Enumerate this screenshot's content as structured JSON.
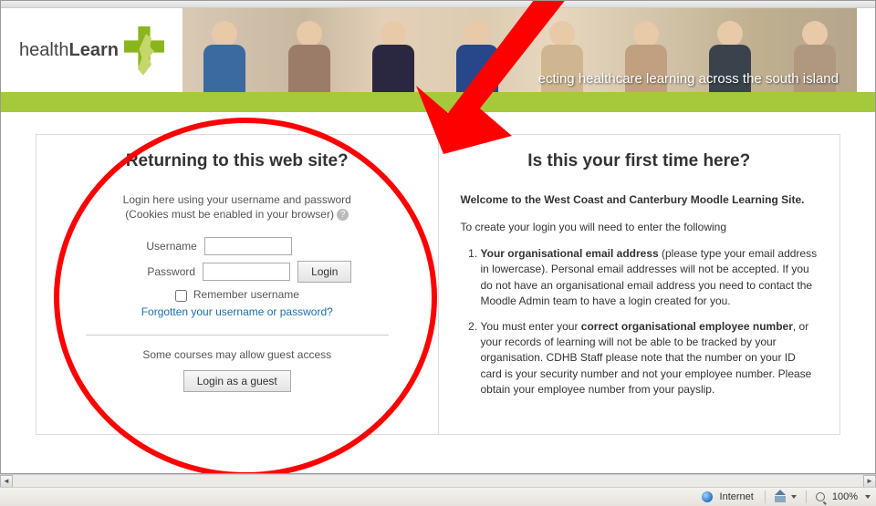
{
  "brand": {
    "name_light": "health",
    "name_bold": "Learn"
  },
  "tagline": "ecting healthcare learning across the south island",
  "login": {
    "title": "Returning to this web site?",
    "desc": "Login here using your username and password",
    "cookies": "(Cookies must be enabled in your browser)",
    "username_label": "Username",
    "password_label": "Password",
    "login_button": "Login",
    "remember_label": "Remember username",
    "forgot_link": "Forgotten your username or password?",
    "guest_note": "Some courses may allow guest access",
    "guest_button": "Login as a guest"
  },
  "first_time": {
    "title": "Is this your first time here?",
    "welcome_bold": "Welcome to the West Coast and Canterbury Moodle Learning Site.",
    "intro_line": "To create your login you will need to enter the following",
    "item1_bold": "Your organisational email address",
    "item1_rest": " (please type your email address in lowercase). Personal email addresses will not be accepted. If you do not have an organisational email address you need to contact the Moodle Admin team to have a login created for you.",
    "item2_pre": "You must enter your ",
    "item2_bold": "correct organisational employee number",
    "item2_rest": ", or your records of learning will not be able to be tracked by your organisation. CDHB Staff please note that the number on your ID card is your security number and not your employee number. Please obtain your employee number from your payslip."
  },
  "status": {
    "zone": "Internet",
    "zoom": "100%"
  }
}
